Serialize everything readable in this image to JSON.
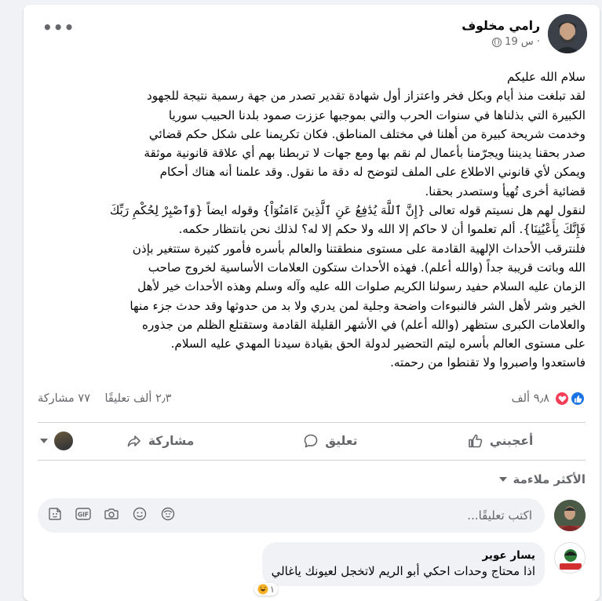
{
  "post": {
    "author": "رامي مخلوف",
    "time": "19 س ·",
    "more_label": "•••",
    "body_lines": [
      "سلام الله عليكم",
      "لقد تبلغت منذ أيام وبكل فخر واعتزاز أول شهادة تقدير تصدر من جهة رسمية نتيجة للجهود",
      "الكبيرة التي بذلناها في سنوات الحرب والتي بموجبها عززت صمود بلدنا الحبيب سوريا",
      "وخدمت شريحة كبيرة من أهلنا في مختلف المناطق. فكان تكريمنا على شكل حكم قضائي",
      "صدر بحقنا يديننا ويجرّمنا بأعمال لم نقم بها ومع جهات لا تربطنا بهم أي علاقة قانونية موثقة",
      "ويمكن لأي قانوني الاطلاع على الملف لتوضح له دقة ما نقول. وقد علمنا أنه هناك أحكام",
      "قضائية أخرى تُهيأ وستصدر بحقنا.",
      "لنقول لهم هل نسيتم قوله تعالى {إِنَّ ٱللَّهَ يُدَٰفِعُ عَنِ ٱلَّذِينَ ءَامَنُوٓاْ} وقوله ايضاً {وَٱصْبِرْ لِحُكْمِ رَبِّكَ",
      "فَإِنَّكَ بِأَعْيُنِنَا}. ألم تعلموا أن لا حاكم إلا الله ولا حكم إلا له؟ لذلك نحن بانتظار حكمه.",
      "فلنترقب الأحداث الإلهية القادمة على مستوى منطقتنا والعالم بأسره فأمور كثيرة ستتغير بإذن",
      "الله وباتت قريبة جداً (والله أعلم). فهذه الأحداث ستكون العلامات الأساسية لخروج صاحب",
      "الزمان عليه السلام حفيد رسولنا الكريم صلوات الله عليه وآله وسلم وهذه الأحداث خير لأهل",
      "الخير وشر لأهل الشر فالنبوءات واضحة وجلية لمن يدري ولا بد من حدوثها وقد حدث جزء منها",
      "والعلامات الكبرى ستظهر (والله أعلم) في الأشهر القليلة القادمة وستقتلع الظلم من جذوره",
      "على مستوى العالم بأسره ليتم التحضير لدولة الحق بقيادة سيدنا المهدي عليه السلام.",
      "فاستعدوا واصبروا ولا تقنطوا من رحمته."
    ]
  },
  "stats": {
    "reactions_count": "٩٫٨ ألف",
    "comments_count": "٢٫٣ ألف تعليقًا",
    "shares_count": "٧٧ مشاركة"
  },
  "actions": {
    "like_label": "أعجبني",
    "comment_label": "تعليق",
    "share_label": "مشاركة"
  },
  "filter": {
    "label": "الأكثر ملاءمة"
  },
  "composer": {
    "placeholder": "اكتب تعليقًا...",
    "icons": [
      "sticker-icon",
      "gif-icon",
      "camera-icon",
      "emoji-icon",
      "avatar-sticker-icon"
    ]
  },
  "reply": {
    "name": "يسار عوير",
    "text": "اذا محتاج وحدات احكي أبو الريم لاتخجل لعيونك ياغالي",
    "reaction_count": "١"
  },
  "colors": {
    "like_blue": "#1b74e4",
    "love_red": "#f33e58",
    "secondary_text": "#65676b"
  }
}
